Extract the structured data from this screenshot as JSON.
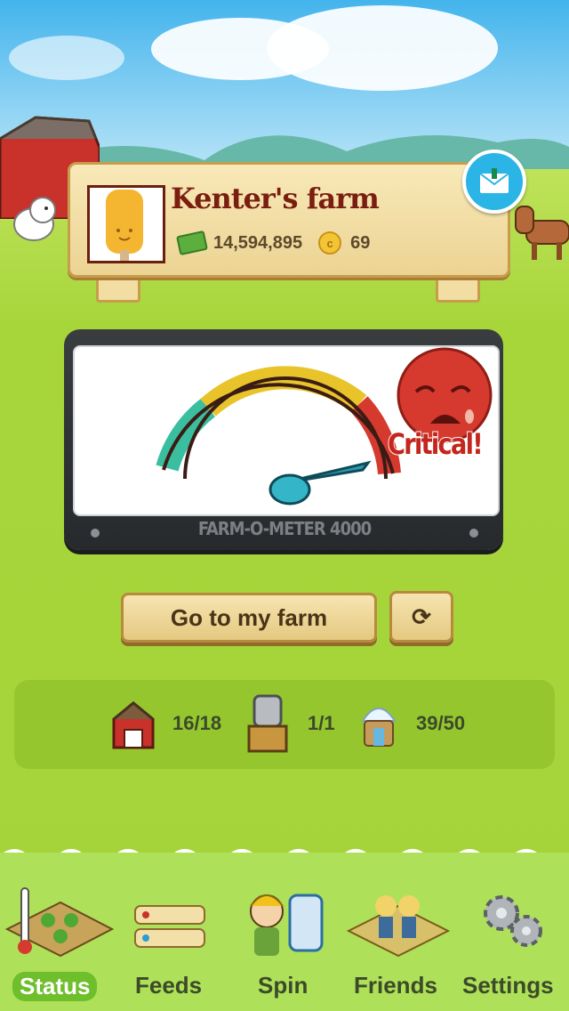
{
  "header": {
    "farm_name": "Kenter's farm",
    "cash": "14,594,895",
    "coins": "69",
    "icons": [
      "cash-icon",
      "coin-icon",
      "message-icon"
    ]
  },
  "meter": {
    "status": "Critical!",
    "brand": "FARM-O-METER 4000",
    "needle_level": 0.96,
    "colors": {
      "green": "#3bbea0",
      "yellow": "#e8c42a",
      "red": "#d6392e"
    }
  },
  "actions": {
    "go_label": "Go to my farm",
    "refresh_icon": "refresh-icon"
  },
  "stats": [
    {
      "icon": "barn-icon",
      "value": "16/18"
    },
    {
      "icon": "silo-icon",
      "value": "1/1"
    },
    {
      "icon": "storage-icon",
      "value": "39/50"
    }
  ],
  "tabs": [
    {
      "label": "Status",
      "icon": "thermometer-field-icon",
      "active": true
    },
    {
      "label": "Feeds",
      "icon": "feeds-icon",
      "active": false
    },
    {
      "label": "Spin",
      "icon": "spin-icon",
      "active": false
    },
    {
      "label": "Friends",
      "icon": "friends-icon",
      "active": false
    },
    {
      "label": "Settings",
      "icon": "gears-icon",
      "active": false
    }
  ]
}
